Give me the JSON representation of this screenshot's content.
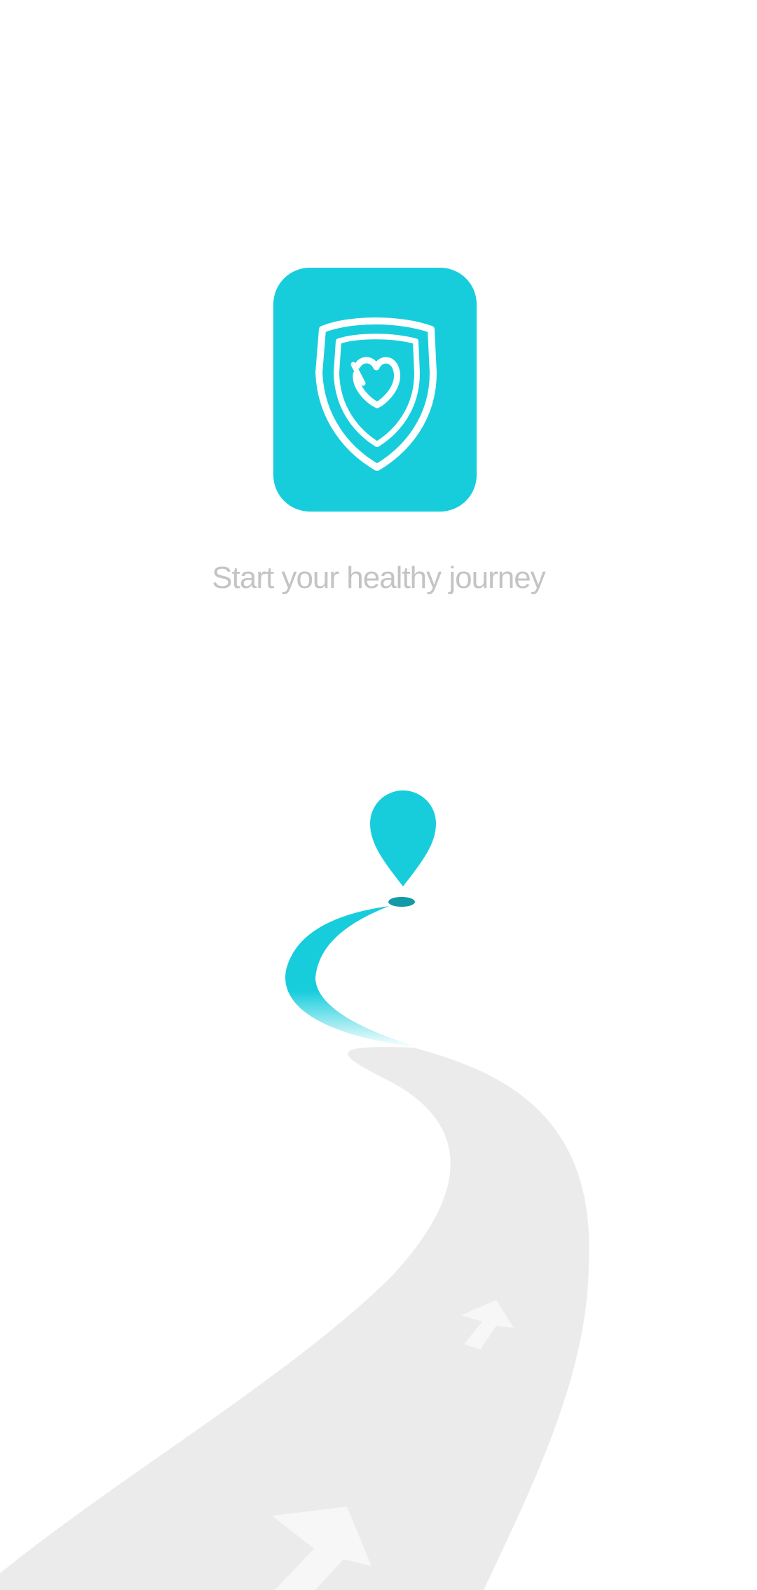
{
  "splash": {
    "tagline": "Start your healthy journey"
  },
  "icons": {
    "logo": "shield-heart-icon",
    "marker": "map-pin-icon",
    "arrows": "arrow-up-icon"
  },
  "colors": {
    "brand": "#17cddc",
    "brand_dark": "#129aa6",
    "road": "#ebebeb",
    "arrow": "#f7f7f7",
    "tagline": "#c4c4c4",
    "background": "#ffffff"
  }
}
